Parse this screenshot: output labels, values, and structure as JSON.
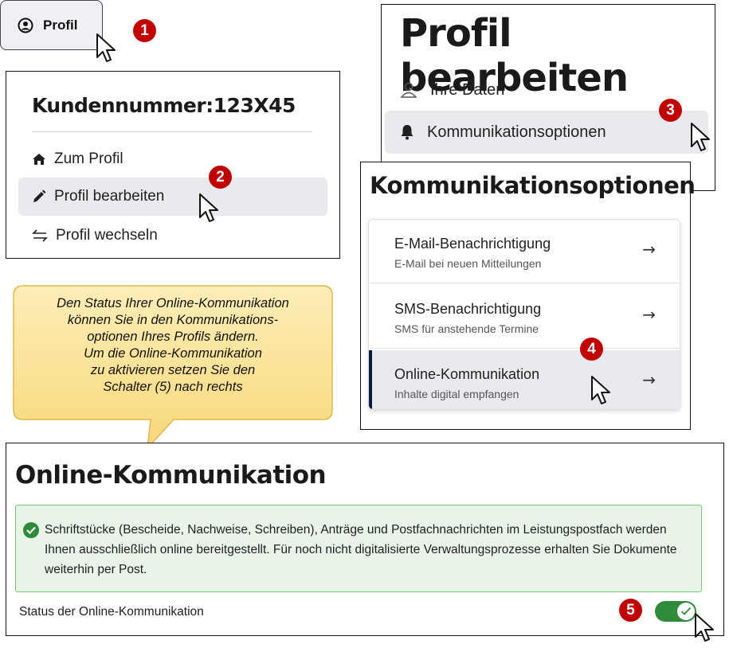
{
  "profile_button": {
    "label": "Profil",
    "icon": "user-circle-icon"
  },
  "customer_menu": {
    "title": "Kundennummer:123X45",
    "items": [
      {
        "label": "Zum Profil",
        "icon": "home-icon"
      },
      {
        "label": "Profil bearbeiten",
        "icon": "pencil-icon",
        "active": true
      },
      {
        "label": "Profil wechseln",
        "icon": "swap-arrows-icon"
      }
    ]
  },
  "edit_profile": {
    "title": "Profil bearbeiten",
    "items": [
      {
        "label": "Ihre Daten",
        "icon": "user-outline-icon"
      },
      {
        "label": "Kommunikationsoptionen",
        "icon": "bell-icon",
        "active": true
      }
    ]
  },
  "communication_options": {
    "title": "Kommunikationsoptionen",
    "options": [
      {
        "title": "E-Mail-Benachrichtigung",
        "subtitle": "E-Mail bei neuen Mitteilungen"
      },
      {
        "title": "SMS-Benachrichtigung",
        "subtitle": "SMS für anstehende Termine"
      },
      {
        "title": "Online-Kommunikation",
        "subtitle": "Inhalte digital empfangen",
        "active": true
      }
    ],
    "arrow": "→"
  },
  "callout": {
    "lines": [
      "Den Status Ihrer Online-Kommunikation",
      "können Sie in den Kommunikations-",
      "optionen Ihres Profils ändern.",
      "Um die Online-Kommunikation",
      "zu aktivieren setzen Sie den",
      "Schalter (5) nach rechts"
    ]
  },
  "online_communication": {
    "title": "Online-Kommunikation",
    "notice": "Schriftstücke (Bescheide, Nachweise, Schreiben), Anträge und Postfachnachrichten im Leistungspostfach werden Ihnen ausschließlich online bereitgestellt. Für noch nicht digitalisierte Verwaltungsprozesse erhalten Sie Dokumente weiterhin per Post.",
    "status_label": "Status der Online-Kommunikation",
    "toggle_on": true
  },
  "steps": [
    "1",
    "2",
    "3",
    "4",
    "5"
  ],
  "colors": {
    "badge": "#c00000",
    "success": "#2e8b3a",
    "notice_bg": "#e8f4e8",
    "callout_bg": "#fbe49a",
    "active_bg": "#e9eaed"
  }
}
